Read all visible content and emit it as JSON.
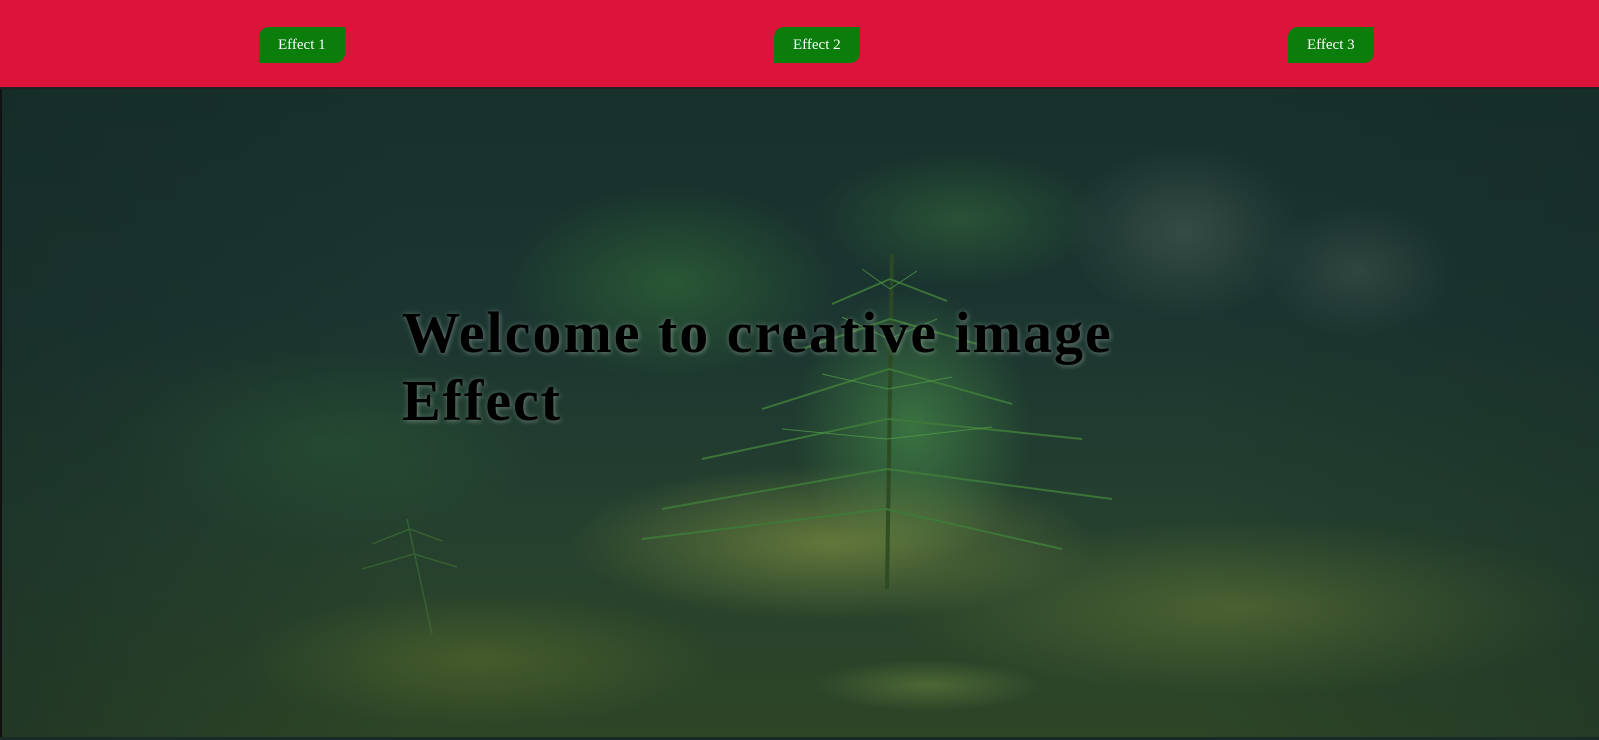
{
  "navbar": {
    "buttons": [
      {
        "label": "Effect 1"
      },
      {
        "label": "Effect 2"
      },
      {
        "label": "Effect 3"
      }
    ],
    "background_color": "#dc143c",
    "button_color": "#0a7d0a"
  },
  "hero": {
    "headline": "Welcome to creative image Effect",
    "image_subject": "forest-seedling-photo"
  }
}
